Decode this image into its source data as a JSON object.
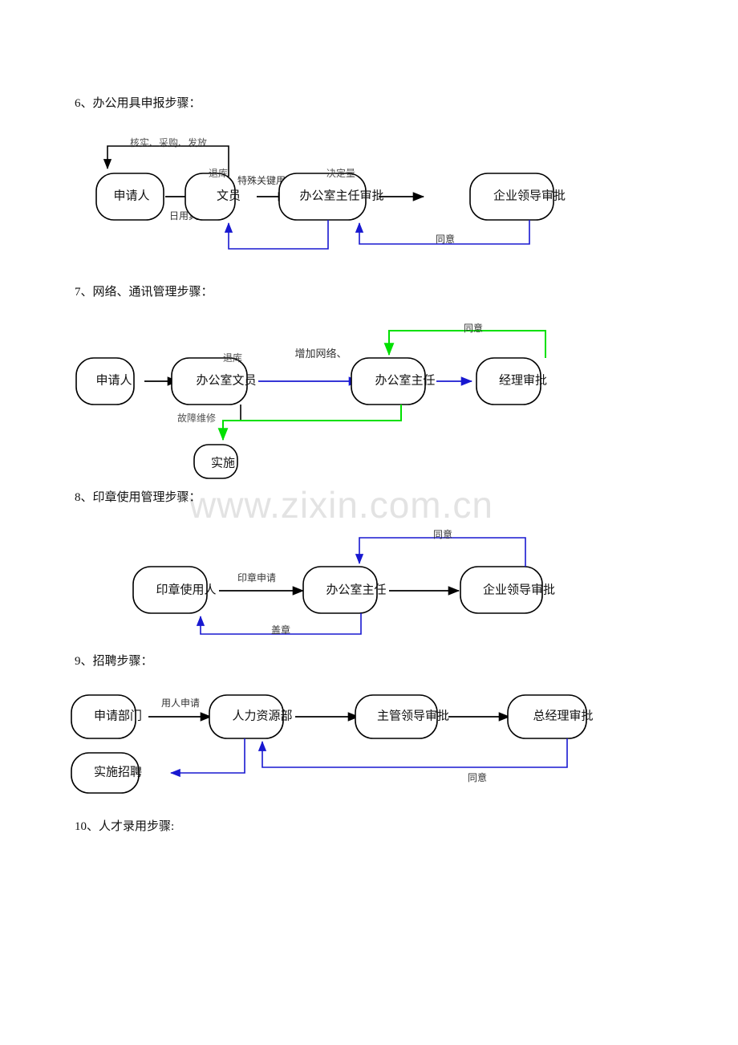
{
  "document": {
    "watermark": "www.zixin.com.cn"
  },
  "sections": [
    {
      "id": "s6",
      "heading": "6、办公用具申报步骤：",
      "diagram": {
        "nodes": [
          {
            "id": "n1",
            "label": "申请人"
          },
          {
            "id": "n2",
            "label": "文员"
          },
          {
            "id": "n3",
            "label": "办公室主任审批"
          },
          {
            "id": "n4",
            "label": "企业领导审批"
          }
        ],
        "edge_labels": {
          "top_return": "核实、采购、发放",
          "restock": "退库",
          "daily": "日用具",
          "special": "特殊关键用具",
          "decide": "决定量",
          "agree": "同意"
        }
      }
    },
    {
      "id": "s7",
      "heading": "7、网络、通讯管理步骤：",
      "diagram": {
        "nodes": [
          {
            "id": "n1",
            "label": "申请人"
          },
          {
            "id": "n2",
            "label": "办公室文员"
          },
          {
            "id": "n3",
            "label": "办公室主任"
          },
          {
            "id": "n4",
            "label": "经理审批"
          },
          {
            "id": "n5",
            "label": "实施"
          }
        ],
        "edge_labels": {
          "restock": "退库",
          "add_network": "增加网络、",
          "repair": "故障维修",
          "agree": "同意"
        }
      }
    },
    {
      "id": "s8",
      "heading": "8、印章使用管理步骤：",
      "diagram": {
        "nodes": [
          {
            "id": "n1",
            "label": "印章使用人"
          },
          {
            "id": "n2",
            "label": "办公室主任"
          },
          {
            "id": "n3",
            "label": "企业领导审批"
          }
        ],
        "edge_labels": {
          "apply": "印章申请",
          "agree": "同意",
          "stamp": "盖章"
        }
      }
    },
    {
      "id": "s9",
      "heading": "9、招聘步骤：",
      "diagram": {
        "nodes": [
          {
            "id": "n1",
            "label": "申请部门"
          },
          {
            "id": "n2",
            "label": "人力资源部"
          },
          {
            "id": "n3",
            "label": "主管领导审批"
          },
          {
            "id": "n4",
            "label": "总经理审批"
          },
          {
            "id": "n5",
            "label": "实施招聘"
          }
        ],
        "edge_labels": {
          "request": "用人申请",
          "agree": "同意"
        }
      }
    },
    {
      "id": "s10",
      "heading": "10、人才录用步骤:"
    }
  ],
  "colors": {
    "black": "#000000",
    "blue": "#1818d0",
    "green": "#00e000",
    "watermark": "#e3e3e3"
  }
}
